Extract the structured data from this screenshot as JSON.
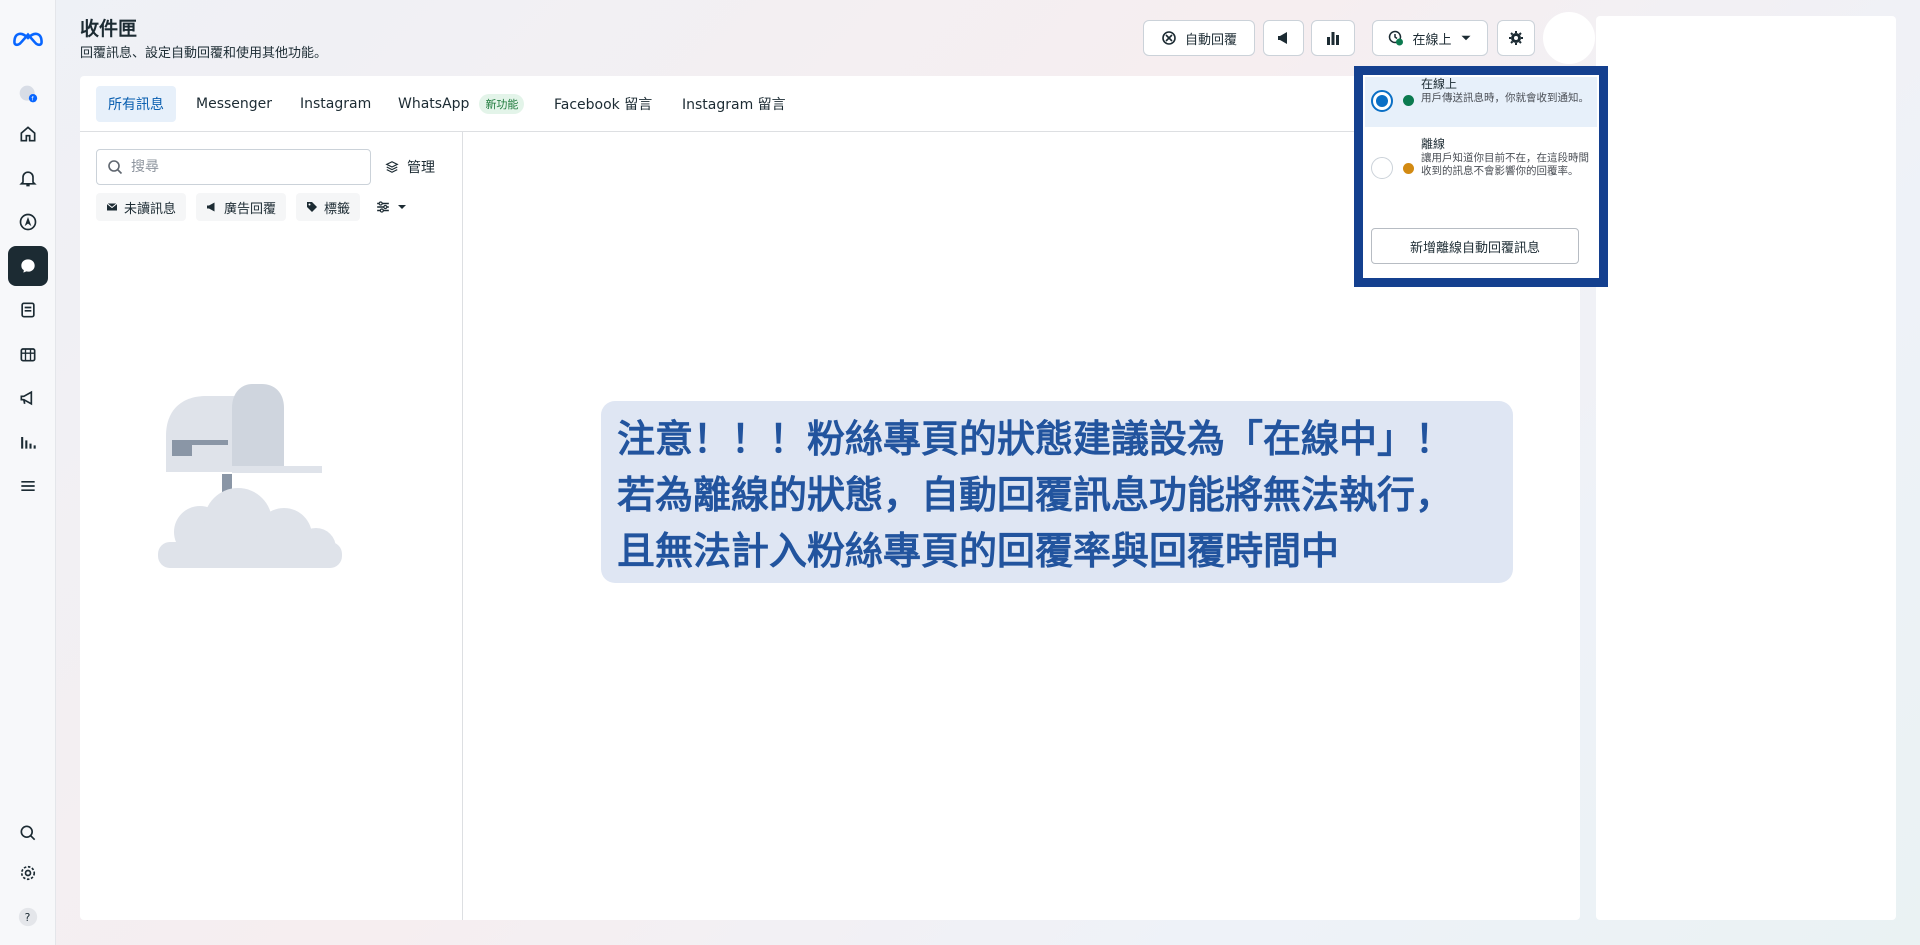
{
  "header": {
    "title": "收件匣",
    "subtitle": "回覆訊息、設定自動回覆和使用其他功能。",
    "auto_reply_label": "自動回覆",
    "status_label": "在線上"
  },
  "tabs": [
    {
      "label": "所有訊息"
    },
    {
      "label": "Messenger"
    },
    {
      "label": "Instagram"
    },
    {
      "label": "WhatsApp",
      "badge": "新功能"
    },
    {
      "label": "Facebook 留言"
    },
    {
      "label": "Instagram 留言"
    }
  ],
  "list": {
    "search_placeholder": "搜尋",
    "manage_label": "管理",
    "filters": [
      {
        "label": "未讀訊息"
      },
      {
        "label": "廣告回覆"
      },
      {
        "label": "標籤"
      }
    ]
  },
  "notice": {
    "line1": "注意！！！粉絲專頁的狀態建議設為「在線中」！",
    "line2": "若為離線的狀態，自動回覆訊息功能將無法執行，",
    "line3": "且無法計入粉絲專頁的回覆率與回覆時間中"
  },
  "status_dropdown": {
    "options": [
      {
        "title": "在線上",
        "desc": "用戶傳送訊息時，你就會收到通知。",
        "selected": true,
        "color": "#0b7a4f"
      },
      {
        "title": "離線",
        "desc": "讓用戶知道你目前不在，在這段時間收到的訊息不會影響你的回覆率。",
        "selected": false,
        "color": "#d28a12"
      }
    ],
    "away_button_label": "新增離線自動回覆訊息"
  },
  "colors": {
    "highlight_frame": "#14408f",
    "notice_text": "#22549e",
    "notice_bg": "#dfe6f3",
    "rail_active": "#1c2b33"
  }
}
